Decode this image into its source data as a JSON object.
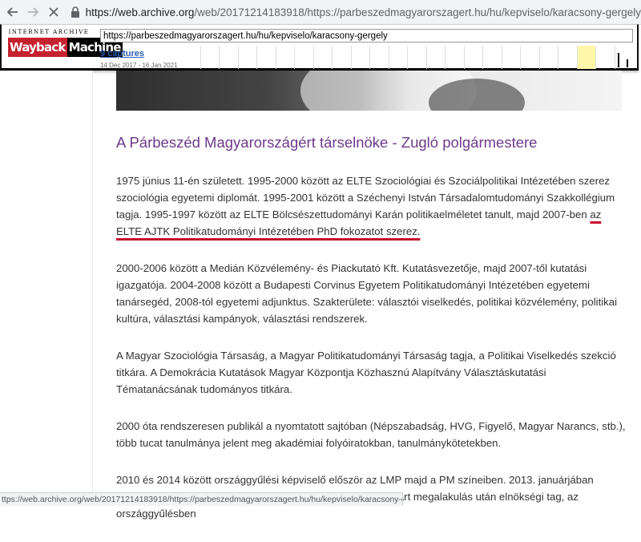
{
  "browser": {
    "url_host": "https://web.archive.org",
    "url_rest": "/web/20171214183918/https://parbeszedmagyarorszagert.hu/hu/kepviselo/karacsony-gergely"
  },
  "wayback": {
    "logo_top": "INTERNET ARCHIVE",
    "logo_left": "Wayback",
    "logo_right": "Machine",
    "archived_url": "https://parbeszedmagyarorszagert.hu/hu/kepviselo/karacsony-gergely",
    "captures_label": "9 captures",
    "date_range": "14 Dec 2017 - 16 Jan 2021"
  },
  "article": {
    "title": "A Párbeszéd Magyarországért társelnöke - Zugló polgármestere",
    "p1_before": "1975 június 11-én született. 1995-2000 között az ELTE Szociológiai és Szociálpolitikai Intézetében szerez szociológia egyetemi diplomát. 1995-2001 között a Széchenyi István Társadalomtudományi Szakkollégium tagja. 1995-1997 között az ELTE Bölcsészettudományi Karán politikaelméletet tanult, majd 2007-ben ",
    "p1_underlined": "az ELTE AJTK Politikatudományi Intézetében PhD fokozatot szerez.",
    "p2": "2000-2006 között a Medián Közvélemény- és Piackutató Kft. Kutatásvezetője, majd 2007-től kutatási igazgatója. 2004-2008 között a Budapesti Corvinus Egyetem Politikatudományi Intézetében egyetemi tanársegéd, 2008-tól egyetemi adjunktus. Szakterülete: választói viselkedés, politikai közvélemény, politikai kultúra, választási kampányok, választási rendszerek.",
    "p3": "A Magyar Szociológia Társaság, a Magyar Politikatudományi Társaság tagja, a Politikai Viselkedés szekció titkára. A Demokrácia Kutatások Magyar Központja Közhasznú Alapítvány Választáskutatási Tématanácsának tudományos titkára.",
    "p4": "2000 óta rendszeresen publikál a nyomtatott sajtóban (Népszabadság, HVG, Figyelő, Magyar Narancs, stb.), több tucat tanulmánya jelent meg akadémiai folyóiratokban, tanulmánykötetekben.",
    "p5": "2010 és 2014 között országgyűlési képviselő először az LMP majd a PM színeiben. 2013. januárjában kilépett az LMP-ből és részt vett a PM megalapításában. A párt megalakulás után elnökségi tag, az országgyűlésben"
  },
  "status_bar": {
    "text": "ttps://web.archive.org/web/20171214183918/https://parbeszedmagyarorszagert.hu/hu/kepviselo/karacsony-gergely#close"
  },
  "colors": {
    "title": "#6e3a8c",
    "underline": "#c8102e",
    "wayback_red": "#c52230"
  }
}
